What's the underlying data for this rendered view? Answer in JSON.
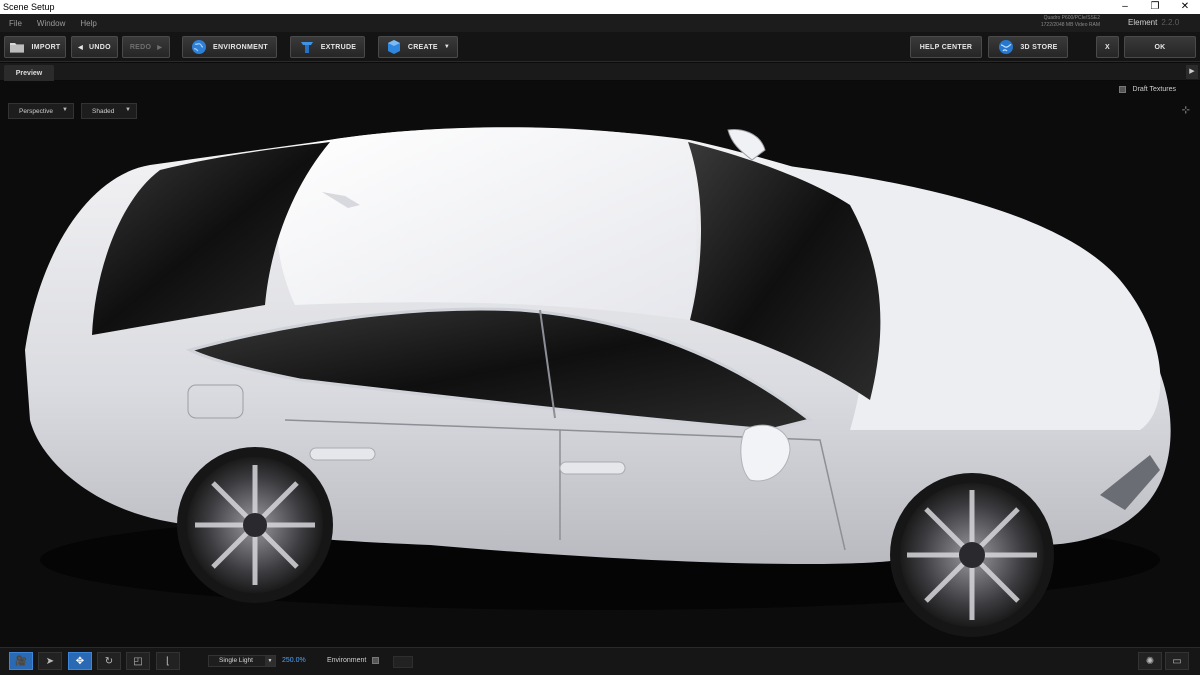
{
  "window": {
    "title": "Scene Setup",
    "minimize": "–",
    "maximize": "❐",
    "close": "✕"
  },
  "menu": {
    "items": [
      "File",
      "Window",
      "Help"
    ],
    "gpu_line1": "Quadro P600/PCIe/SSE2",
    "gpu_line2": "1722/2048 MB Video RAM",
    "product": "Element",
    "version": "2.2.0"
  },
  "toolbar": {
    "import": "IMPORT",
    "undo": "UNDO",
    "redo": "REDO",
    "environment": "ENVIRONMENT",
    "extrude": "EXTRUDE",
    "create": "CREATE",
    "help_center": "HELP CENTER",
    "store": "3D STORE",
    "cancel": "X",
    "ok": "OK"
  },
  "tabs": {
    "preview": "Preview"
  },
  "viewport": {
    "camera": "Perspective",
    "shading": "Shaded",
    "draft_textures": "Draft Textures",
    "draft_checked": false
  },
  "status": {
    "light_mode": "Single Light",
    "light_value": "250.0%",
    "environment_label": "Environment",
    "environment_checked": false,
    "active_tool": "camera",
    "accent_color": "#2a6ab5"
  },
  "icons": [
    "folder-icon",
    "undo-arrow-icon",
    "redo-arrow-icon",
    "globe-icon",
    "extrude-icon",
    "cube-icon",
    "store-globe-icon",
    "camera-icon",
    "pointer-icon",
    "move-icon",
    "rotate-icon",
    "scale-icon",
    "axis-icon",
    "settings-icon",
    "screen-icon",
    "chevron-right-icon",
    "expand-icon"
  ]
}
